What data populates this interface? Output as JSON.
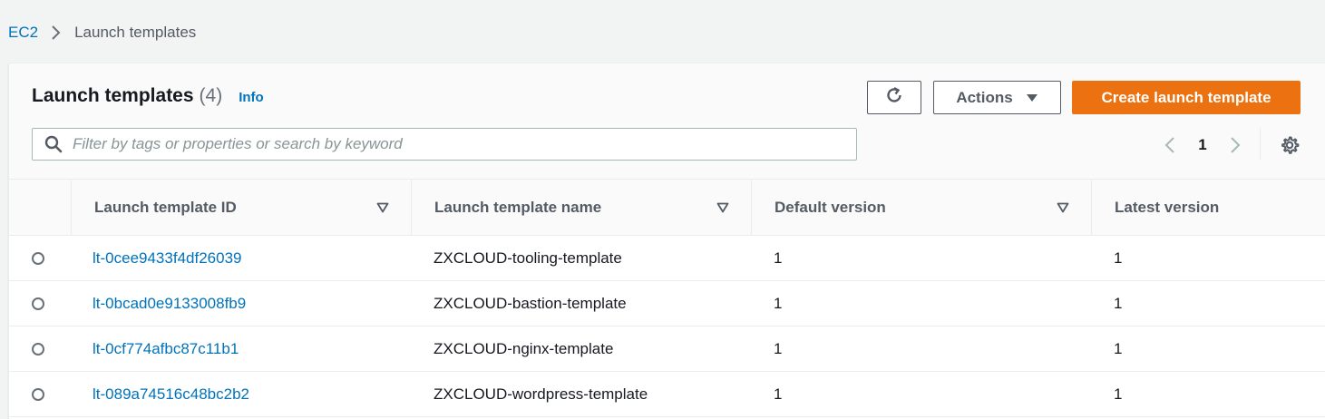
{
  "breadcrumb": {
    "root": "EC2",
    "current": "Launch templates"
  },
  "header": {
    "title": "Launch templates",
    "count": "(4)",
    "info": "Info",
    "actions_label": "Actions",
    "create_label": "Create launch template"
  },
  "search": {
    "placeholder": "Filter by tags or properties or search by keyword",
    "value": ""
  },
  "pagination": {
    "current_page": "1"
  },
  "table": {
    "columns": [
      "Launch template ID",
      "Launch template name",
      "Default version",
      "Latest version"
    ],
    "rows": [
      {
        "id": "lt-0cee9433f4df26039",
        "name": "ZXCLOUD-tooling-template",
        "default_version": "1",
        "latest_version": "1"
      },
      {
        "id": "lt-0bcad0e9133008fb9",
        "name": "ZXCLOUD-bastion-template",
        "default_version": "1",
        "latest_version": "1"
      },
      {
        "id": "lt-0cf774afbc87c11b1",
        "name": "ZXCLOUD-nginx-template",
        "default_version": "1",
        "latest_version": "1"
      },
      {
        "id": "lt-089a74516c48bc2b2",
        "name": "ZXCLOUD-wordpress-template",
        "default_version": "1",
        "latest_version": "1"
      }
    ]
  },
  "icons": {
    "breadcrumb_separator": "chevron-right-icon",
    "refresh": "refresh-icon",
    "actions_caret": "caret-down-icon",
    "search": "search-icon",
    "prev_page": "chevron-left-icon",
    "next_page": "chevron-right-icon",
    "settings": "gear-icon",
    "sort": "sort-down-icon"
  },
  "colors": {
    "link": "#0073bb",
    "primary_button": "#ec7211",
    "background": "#f2f3f3",
    "text": "#16191f",
    "muted_text": "#545b64"
  }
}
